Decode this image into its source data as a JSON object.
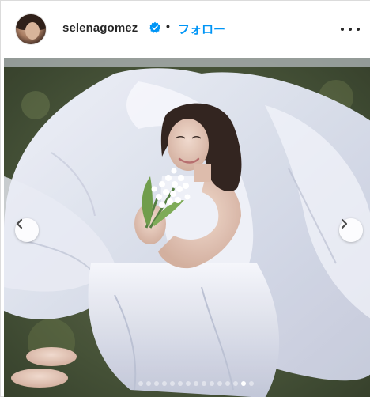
{
  "header": {
    "username": "selenagomez",
    "separator": "•",
    "follow_label": "フォロー"
  },
  "icons": {
    "avatar": "profile-photo",
    "verified": "verified-badge-icon",
    "more": "more-options-icon",
    "prev": "chevron-left-icon",
    "next": "chevron-right-icon"
  },
  "carousel": {
    "total_slides": 15,
    "active_index": 13
  },
  "colors": {
    "accent": "#0095f6",
    "text": "#262626"
  }
}
